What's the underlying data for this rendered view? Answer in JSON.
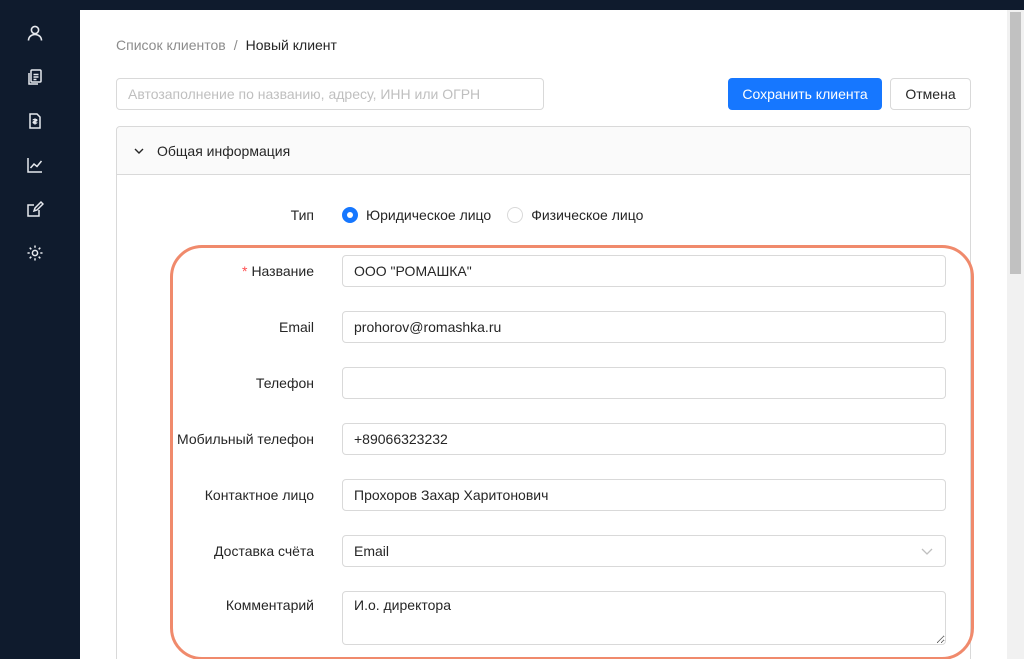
{
  "sidebar": {
    "items": [
      {
        "icon": "user-icon"
      },
      {
        "icon": "documents-icon"
      },
      {
        "icon": "invoice-icon"
      },
      {
        "icon": "chart-icon"
      },
      {
        "icon": "edit-icon"
      },
      {
        "icon": "gear-icon"
      }
    ]
  },
  "breadcrumb": {
    "parent": "Список клиентов",
    "separator": "/",
    "current": "Новый клиент"
  },
  "search": {
    "placeholder": "Автозаполнение по названию, адресу, ИНН или ОГРН",
    "value": ""
  },
  "actions": {
    "save_label": "Сохранить клиента",
    "cancel_label": "Отмена"
  },
  "panel": {
    "title": "Общая информация"
  },
  "form": {
    "type_label": "Тип",
    "type_options": [
      "Юридическое лицо",
      "Физическое лицо"
    ],
    "type_selected": "Юридическое лицо",
    "name_label": "Название",
    "name_value": "ООО \"РОМАШКА\"",
    "email_label": "Email",
    "email_value": "prohorov@romashka.ru",
    "phone_label": "Телефон",
    "phone_value": "",
    "mobile_label": "Мобильный телефон",
    "mobile_value": "+89066323232",
    "contact_label": "Контактное лицо",
    "contact_value": "Прохоров Захар Харитонович",
    "delivery_label": "Доставка счёта",
    "delivery_value": "Email",
    "comment_label": "Комментарий",
    "comment_value": "И.о. директора"
  },
  "colors": {
    "primary": "#1677ff",
    "sidebar": "#0f1b2d",
    "highlight": "#f08a6c",
    "required": "#ff4d4f"
  }
}
